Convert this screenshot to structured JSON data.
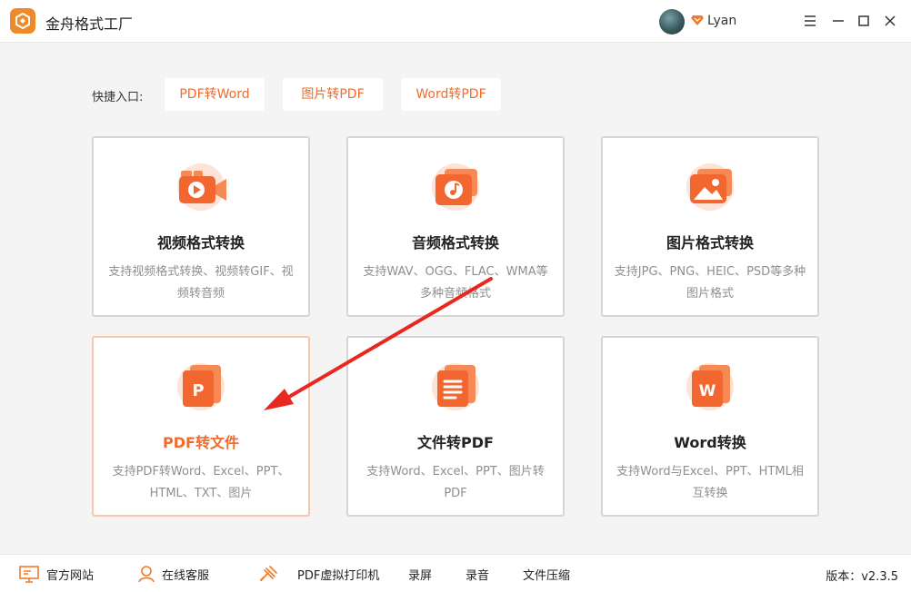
{
  "app": {
    "title": "金舟格式工厂"
  },
  "user": {
    "name": "Lyan"
  },
  "quick": {
    "label": "快捷入口:",
    "buttons": [
      "PDF转Word",
      "图片转PDF",
      "Word转PDF"
    ]
  },
  "cards": [
    {
      "title": "视频格式转换",
      "desc": "支持视频格式转换、视频转GIF、视频转音频",
      "icon": "video-camera-icon"
    },
    {
      "title": "音频格式转换",
      "desc": "支持WAV、OGG、FLAC、WMA等多种音频格式",
      "icon": "music-note-icon"
    },
    {
      "title": "图片格式转换",
      "desc": "支持JPG、PNG、HEIC、PSD等多种图片格式",
      "icon": "image-icon"
    },
    {
      "title": "PDF转文件",
      "desc": "支持PDF转Word、Excel、PPT、HTML、TXT、图片",
      "icon": "pdf-p-icon"
    },
    {
      "title": "文件转PDF",
      "desc": "支持Word、Excel、PPT、图片转PDF",
      "icon": "document-icon"
    },
    {
      "title": "Word转换",
      "desc": "支持Word与Excel、PPT、HTML相互转换",
      "icon": "word-w-icon"
    }
  ],
  "footer": {
    "items": [
      "官方网站",
      "在线客服",
      "PDF虚拟打印机",
      "录屏",
      "录音",
      "文件压缩"
    ],
    "version": "版本：v2.3.5"
  },
  "colors": {
    "accent": "#ef6c2b",
    "logo": "#ee8a2a",
    "arrow": "#e8281f"
  }
}
